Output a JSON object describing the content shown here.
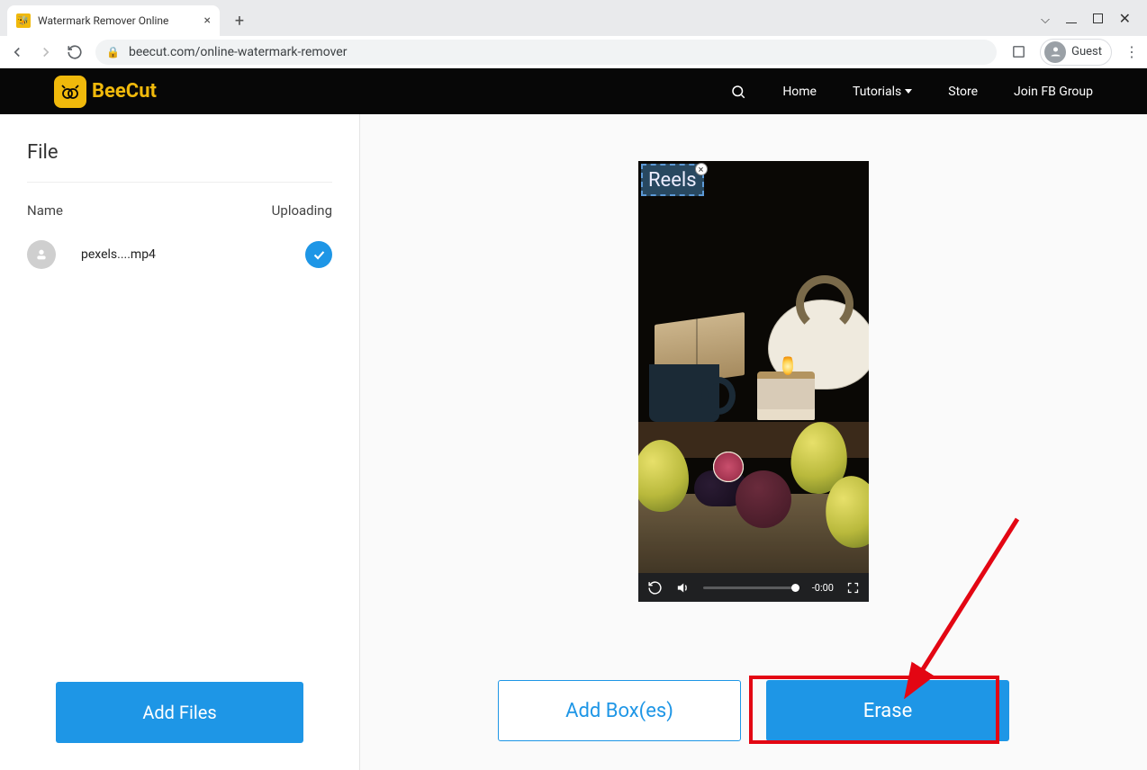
{
  "browser": {
    "tab_title": "Watermark Remover Online",
    "url": "beecut.com/online-watermark-remover",
    "guest_label": "Guest"
  },
  "site": {
    "brand": "BeeCut",
    "nav": {
      "home": "Home",
      "tutorials": "Tutorials",
      "store": "Store",
      "fbgroup": "Join FB Group"
    }
  },
  "sidebar": {
    "title": "File",
    "col_name": "Name",
    "col_status": "Uploading",
    "file": {
      "name": "pexels....mp4"
    },
    "add_files": "Add Files"
  },
  "editor": {
    "watermark_text": "Reels",
    "time": "-0:00",
    "actions": {
      "add_boxes": "Add Box(es)",
      "erase": "Erase"
    }
  }
}
